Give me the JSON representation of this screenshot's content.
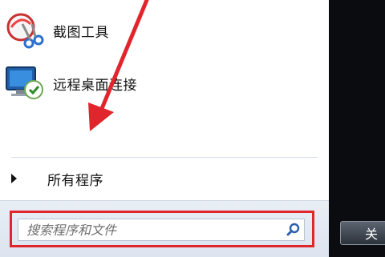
{
  "start_menu": {
    "programs": [
      {
        "label": "截图工具",
        "icon": "snipping-tool-icon"
      },
      {
        "label": "远程桌面连接",
        "icon": "remote-desktop-icon"
      }
    ],
    "all_programs_label": "所有程序",
    "search": {
      "placeholder": "搜索程序和文件",
      "value": ""
    },
    "shutdown_label": "关"
  },
  "annotations": {
    "arrow_color": "#e0262c",
    "highlight_color": "#e0262c"
  }
}
